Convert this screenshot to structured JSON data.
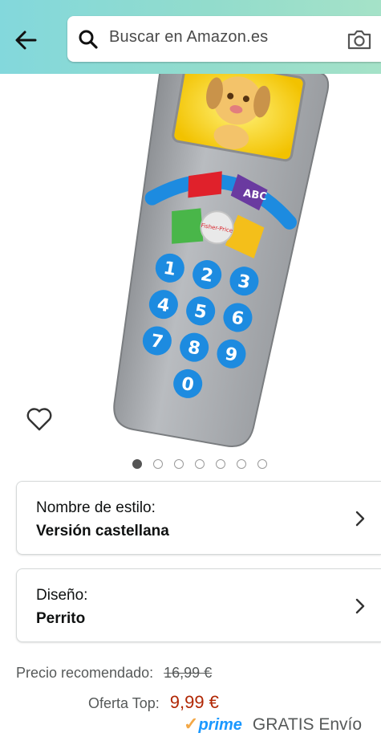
{
  "header": {
    "search_placeholder": "Buscar en Amazon.es"
  },
  "product_image": {
    "keypad_digits": [
      "1",
      "2",
      "3",
      "4",
      "5",
      "6",
      "7",
      "8",
      "9",
      "0"
    ],
    "brand_badge": "Fisher-Price"
  },
  "gallery": {
    "total_images": 7,
    "active_index": 0
  },
  "style_option": {
    "label": "Nombre de estilo:",
    "value": "Versión castellana"
  },
  "design_option": {
    "label": "Diseño:",
    "value": "Perrito"
  },
  "pricing": {
    "recommended_label": "Precio recomendado:",
    "recommended_price": "16,99 €",
    "offer_label": "Oferta Top:",
    "offer_price": "9,99 €",
    "prime_check": "✓",
    "prime_word": "prime",
    "shipping_text": "GRATIS Envío"
  },
  "colors": {
    "header_gradient_start": "#83d8dc",
    "header_gradient_end": "#a5e2c8",
    "offer_price": "#b12704",
    "prime_blue": "#1a98ff",
    "prime_check": "#f3a847"
  }
}
